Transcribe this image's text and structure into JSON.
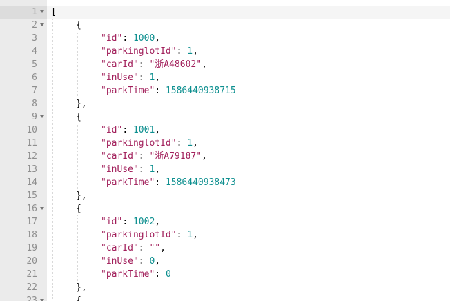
{
  "lines": [
    {
      "no": "1",
      "fold": true,
      "indent": 0,
      "t": [
        {
          "c": "punc",
          "v": "["
        }
      ]
    },
    {
      "no": "2",
      "fold": true,
      "indent": 1,
      "t": [
        {
          "c": "punc",
          "v": "{"
        }
      ]
    },
    {
      "no": "3",
      "fold": false,
      "indent": 2,
      "t": [
        {
          "c": "key",
          "v": "\"id\""
        },
        {
          "c": "punc",
          "v": ": "
        },
        {
          "c": "num",
          "v": "1000"
        },
        {
          "c": "punc",
          "v": ","
        }
      ]
    },
    {
      "no": "4",
      "fold": false,
      "indent": 2,
      "t": [
        {
          "c": "key",
          "v": "\"parkinglotId\""
        },
        {
          "c": "punc",
          "v": ": "
        },
        {
          "c": "num",
          "v": "1"
        },
        {
          "c": "punc",
          "v": ","
        }
      ]
    },
    {
      "no": "5",
      "fold": false,
      "indent": 2,
      "t": [
        {
          "c": "key",
          "v": "\"carId\""
        },
        {
          "c": "punc",
          "v": ": "
        },
        {
          "c": "str",
          "v": "\"浙A48602\""
        },
        {
          "c": "punc",
          "v": ","
        }
      ]
    },
    {
      "no": "6",
      "fold": false,
      "indent": 2,
      "t": [
        {
          "c": "key",
          "v": "\"inUse\""
        },
        {
          "c": "punc",
          "v": ": "
        },
        {
          "c": "num",
          "v": "1"
        },
        {
          "c": "punc",
          "v": ","
        }
      ]
    },
    {
      "no": "7",
      "fold": false,
      "indent": 2,
      "t": [
        {
          "c": "key",
          "v": "\"parkTime\""
        },
        {
          "c": "punc",
          "v": ": "
        },
        {
          "c": "num",
          "v": "1586440938715"
        }
      ]
    },
    {
      "no": "8",
      "fold": false,
      "indent": 1,
      "t": [
        {
          "c": "punc",
          "v": "},"
        }
      ]
    },
    {
      "no": "9",
      "fold": true,
      "indent": 1,
      "t": [
        {
          "c": "punc",
          "v": "{"
        }
      ]
    },
    {
      "no": "10",
      "fold": false,
      "indent": 2,
      "t": [
        {
          "c": "key",
          "v": "\"id\""
        },
        {
          "c": "punc",
          "v": ": "
        },
        {
          "c": "num",
          "v": "1001"
        },
        {
          "c": "punc",
          "v": ","
        }
      ]
    },
    {
      "no": "11",
      "fold": false,
      "indent": 2,
      "t": [
        {
          "c": "key",
          "v": "\"parkinglotId\""
        },
        {
          "c": "punc",
          "v": ": "
        },
        {
          "c": "num",
          "v": "1"
        },
        {
          "c": "punc",
          "v": ","
        }
      ]
    },
    {
      "no": "12",
      "fold": false,
      "indent": 2,
      "t": [
        {
          "c": "key",
          "v": "\"carId\""
        },
        {
          "c": "punc",
          "v": ": "
        },
        {
          "c": "str",
          "v": "\"浙A79187\""
        },
        {
          "c": "punc",
          "v": ","
        }
      ]
    },
    {
      "no": "13",
      "fold": false,
      "indent": 2,
      "t": [
        {
          "c": "key",
          "v": "\"inUse\""
        },
        {
          "c": "punc",
          "v": ": "
        },
        {
          "c": "num",
          "v": "1"
        },
        {
          "c": "punc",
          "v": ","
        }
      ]
    },
    {
      "no": "14",
      "fold": false,
      "indent": 2,
      "t": [
        {
          "c": "key",
          "v": "\"parkTime\""
        },
        {
          "c": "punc",
          "v": ": "
        },
        {
          "c": "num",
          "v": "1586440938473"
        }
      ]
    },
    {
      "no": "15",
      "fold": false,
      "indent": 1,
      "t": [
        {
          "c": "punc",
          "v": "},"
        }
      ]
    },
    {
      "no": "16",
      "fold": true,
      "indent": 1,
      "t": [
        {
          "c": "punc",
          "v": "{"
        }
      ]
    },
    {
      "no": "17",
      "fold": false,
      "indent": 2,
      "t": [
        {
          "c": "key",
          "v": "\"id\""
        },
        {
          "c": "punc",
          "v": ": "
        },
        {
          "c": "num",
          "v": "1002"
        },
        {
          "c": "punc",
          "v": ","
        }
      ]
    },
    {
      "no": "18",
      "fold": false,
      "indent": 2,
      "t": [
        {
          "c": "key",
          "v": "\"parkinglotId\""
        },
        {
          "c": "punc",
          "v": ": "
        },
        {
          "c": "num",
          "v": "1"
        },
        {
          "c": "punc",
          "v": ","
        }
      ]
    },
    {
      "no": "19",
      "fold": false,
      "indent": 2,
      "t": [
        {
          "c": "key",
          "v": "\"carId\""
        },
        {
          "c": "punc",
          "v": ": "
        },
        {
          "c": "str",
          "v": "\"\""
        },
        {
          "c": "punc",
          "v": ","
        }
      ]
    },
    {
      "no": "20",
      "fold": false,
      "indent": 2,
      "t": [
        {
          "c": "key",
          "v": "\"inUse\""
        },
        {
          "c": "punc",
          "v": ": "
        },
        {
          "c": "num",
          "v": "0"
        },
        {
          "c": "punc",
          "v": ","
        }
      ]
    },
    {
      "no": "21",
      "fold": false,
      "indent": 2,
      "t": [
        {
          "c": "key",
          "v": "\"parkTime\""
        },
        {
          "c": "punc",
          "v": ": "
        },
        {
          "c": "num",
          "v": "0"
        }
      ]
    },
    {
      "no": "22",
      "fold": false,
      "indent": 1,
      "t": [
        {
          "c": "punc",
          "v": "},"
        }
      ]
    },
    {
      "no": "23",
      "fold": true,
      "indent": 1,
      "t": [
        {
          "c": "punc",
          "v": "{"
        }
      ]
    }
  ],
  "active_line": "1",
  "colors": {
    "key": "#a11e5a",
    "string": "#a11e5a",
    "number": "#0d8f8f",
    "gutter": "#ebebeb",
    "line_number": "#8f8f8f"
  }
}
